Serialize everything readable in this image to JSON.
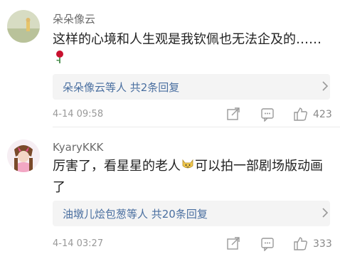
{
  "comments": [
    {
      "username": "朵朵像云",
      "text": "这样的心境和人生观是我钦佩也无法企及的……",
      "emoji": "rose",
      "reply_summary": "朵朵像云等人  共2条回复",
      "timestamp": "4-14 09:58",
      "likes": "423"
    },
    {
      "username": "KyaryKKK",
      "text_line1_a": "厉害了，看星星的老人",
      "text_line1_b": "可以拍一部剧场版动画",
      "text_line2": "了",
      "reply_summary": "油墩儿烩包葱等人  共20条回复",
      "timestamp": "4-14 03:27",
      "likes": "333"
    }
  ],
  "icons": [
    "share-icon",
    "comment-icon",
    "like-icon",
    "chevron-right-icon",
    "rose-icon",
    "cat-face-icon"
  ],
  "colors": {
    "reply_link": "#4a6fa0",
    "meta": "#999999",
    "reply_bg": "#f4f4f4"
  }
}
